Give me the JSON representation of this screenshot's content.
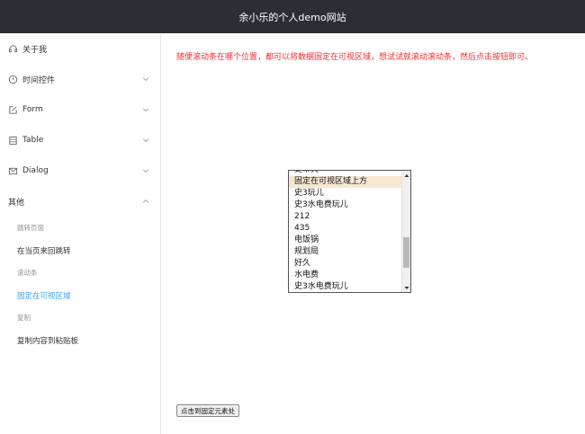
{
  "header": {
    "title": "余小乐的个人demo网站"
  },
  "sidebar": {
    "items": [
      {
        "label": "关于我",
        "icon": "headset-icon"
      },
      {
        "label": "时间控件",
        "icon": "clock-icon"
      },
      {
        "label": "Form",
        "icon": "edit-icon"
      },
      {
        "label": "Table",
        "icon": "table-icon"
      },
      {
        "label": "Dialog",
        "icon": "mail-icon"
      }
    ],
    "other": {
      "label": "其他",
      "groups": [
        {
          "title": "跳转页面",
          "items": [
            "在当页来回跳转"
          ]
        },
        {
          "title": "滚动条",
          "items": [
            "固定在可视区域"
          ]
        },
        {
          "title": "复制",
          "items": [
            "复制内容到粘贴板"
          ]
        }
      ],
      "active_item": "固定在可视区域"
    }
  },
  "main": {
    "notice": "随便滚动条在哪个位置，都可以将数据固定在可视区域，想试试就滚动滚动条，然后点击按钮即可。",
    "notice_color": "#f52b2b",
    "list": {
      "items": [
        "史带关",
        "固定在可视区域上方",
        "史3玩儿",
        "史3水电费玩儿",
        "212",
        "435",
        "电饭锅",
        "规划局",
        "好久",
        "水电费",
        "史3水电费玩儿"
      ],
      "selected_index": 1,
      "scroll_fraction": 0.78
    },
    "button_label": "点击到固定元素处"
  },
  "colors": {
    "header_bg": "#2b2f33",
    "active": "#409eff",
    "selected_row": "#f7e7d2"
  }
}
